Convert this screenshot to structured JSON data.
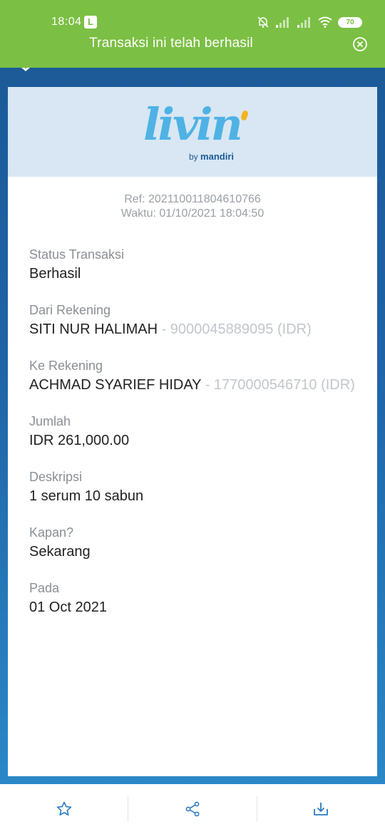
{
  "status_bar": {
    "time": "18:04",
    "notif_badge": "L",
    "battery": "70",
    "icons": [
      "bell-off-icon",
      "signal-icon",
      "signal-icon",
      "wifi-icon",
      "battery-icon"
    ]
  },
  "banner": {
    "message": "Transaksi ini telah berhasil",
    "close_icon": "close-circle-icon",
    "color": "#7bbf44"
  },
  "logo": {
    "word": "livin",
    "by": "by",
    "brand": "mandiri"
  },
  "receipt": {
    "ref": "Ref: 20211001180461076​6",
    "time": "Waktu: 01/10/2021 18:04:50",
    "fields": [
      {
        "label": "Status Transaksi",
        "value": "Berhasil",
        "sub": ""
      },
      {
        "label": "Dari Rekening",
        "value": "SITI NUR HALIMAH",
        "sub": " - 9000045889095 (IDR)"
      },
      {
        "label": "Ke Rekening",
        "value": "ACHMAD SYARIEF HIDAY",
        "sub": " - 1770000546710 (IDR)"
      },
      {
        "label": "Jumlah",
        "value": "IDR 261,000.00",
        "sub": ""
      },
      {
        "label": "Deskripsi",
        "value": "1 serum 10 sabun",
        "sub": ""
      },
      {
        "label": "Kapan?",
        "value": "Sekarang",
        "sub": ""
      },
      {
        "label": "Pada",
        "value": "01 Oct 2021",
        "sub": ""
      }
    ]
  },
  "actions": [
    {
      "icon": "star-icon"
    },
    {
      "icon": "share-icon"
    },
    {
      "icon": "download-icon"
    }
  ],
  "colors": {
    "accent_blue": "#1c5a98",
    "logo_blue": "#4fb2e5",
    "icon_blue": "#2b7bbf"
  }
}
